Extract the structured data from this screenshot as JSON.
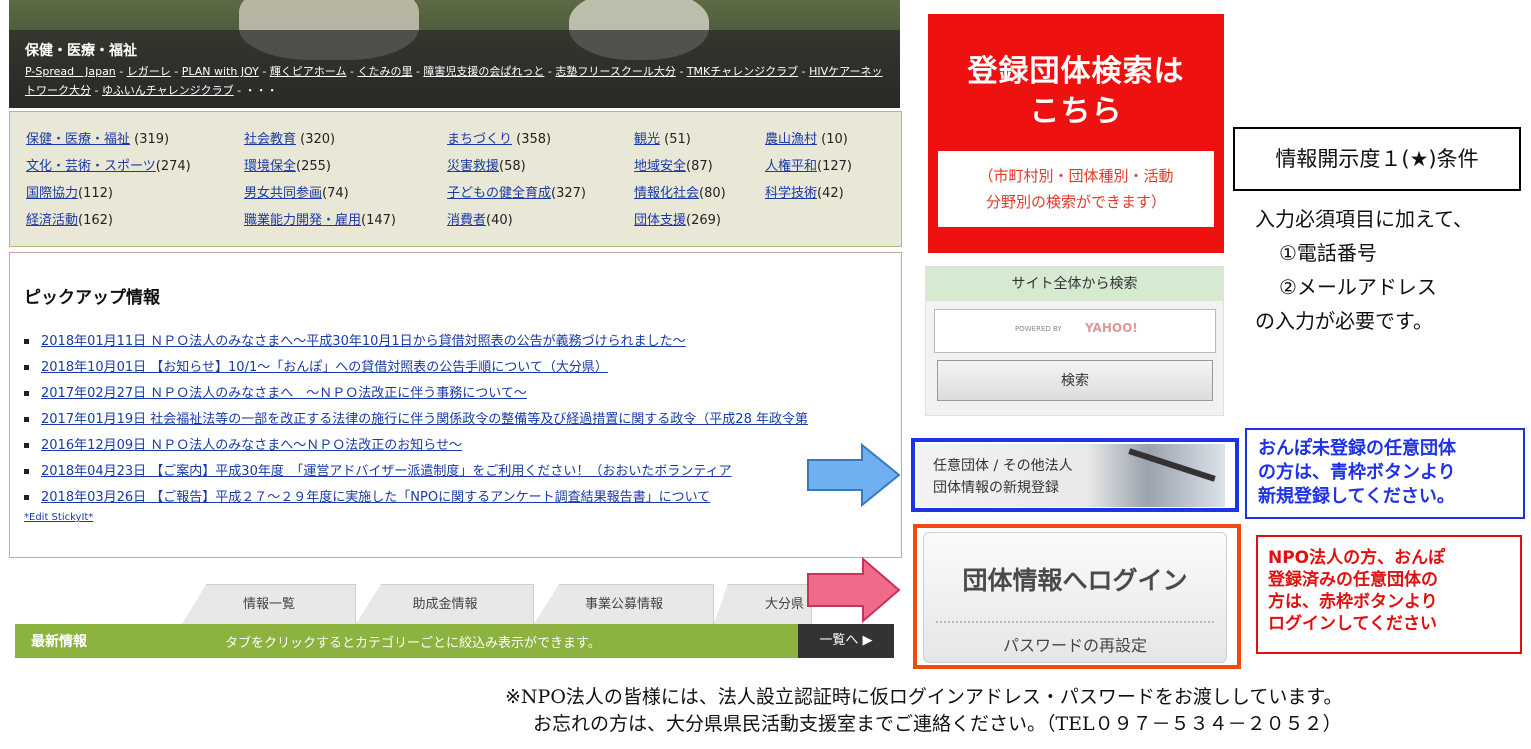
{
  "banner": {
    "category_title": "保健・医療・福祉",
    "links": [
      "P-Spread　Japan",
      "レガーレ",
      "PLAN with JOY",
      "輝くピアホーム",
      "くたみの里",
      "障害児支援の会ぱれっと",
      "志塾フリースクール大分",
      "TMKチャレンジクラブ",
      "HIVケアーネットワーク大分",
      "ゆふいんチャレンジクラブ"
    ],
    "separator": " - ",
    "trailing": " - ・・・"
  },
  "categories": [
    [
      {
        "name": "保健・医療・福祉",
        "count": " (319)"
      },
      {
        "name": "社会教育",
        "count": " (320)"
      },
      {
        "name": "まちづくり",
        "count": " (358)"
      },
      {
        "name": "観光",
        "count": " (51)"
      },
      {
        "name": "農山漁村",
        "count": " (10)"
      }
    ],
    [
      {
        "name": "文化・芸術・スポーツ",
        "count": "(274)"
      },
      {
        "name": "環境保全",
        "count": "(255)"
      },
      {
        "name": "災害救援",
        "count": "(58)"
      },
      {
        "name": "地域安全",
        "count": "(87)"
      },
      {
        "name": "人権平和",
        "count": "(127)"
      }
    ],
    [
      {
        "name": "国際協力",
        "count": "(112)"
      },
      {
        "name": "男女共同参画",
        "count": "(74)"
      },
      {
        "name": "子どもの健全育成",
        "count": "(327)"
      },
      {
        "name": "情報化社会",
        "count": "(80)"
      },
      {
        "name": "科学技術",
        "count": "(42)"
      }
    ],
    [
      {
        "name": "経済活動",
        "count": "(162)"
      },
      {
        "name": "職業能力開発・雇用",
        "count": "(147)"
      },
      {
        "name": "消費者",
        "count": "(40)"
      },
      {
        "name": "団体支援",
        "count": "(269)"
      }
    ]
  ],
  "pickup": {
    "title": "ピックアップ情報",
    "items": [
      "2018年01月11日 ＮＰＯ法人のみなさまへ～平成30年10月1日から貸借対照表の公告が義務づけられました～",
      "2018年10月01日 【お知らせ】10/1～「おんぽ」への貸借対照表の公告手順について（大分県）",
      "2017年02月27日 ＮＰＯ法人のみなさまへ　～ＮＰＯ法改正に伴う事務について～",
      "2017年01月19日 社会福祉法等の一部を改正する法律の施行に伴う関係政令の整備等及び経過措置に関する政令（平成28 年政令第",
      "2016年12月09日 ＮＰＯ法人のみなさまへ～ＮＰＯ法改正のお知らせ～",
      "2018年04月23日 【ご案内】平成30年度　「運営アドバイザー派遣制度」をご利用ください！（おおいたボランティア",
      "2018年03月26日 【ご報告】平成２７～２９年度に実施した「NPOに関するアンケート調査結果報告書」について"
    ],
    "edit_link": "*Edit StickyIt*"
  },
  "tabs": [
    "情報一覧",
    "助成金情報",
    "事業公募情報",
    "大分県"
  ],
  "latest": {
    "title": "最新情報",
    "hint": "タブをクリックするとカテゴリーごとに絞込み表示ができます。",
    "more": "一覧へ ▶"
  },
  "red_button": {
    "line1": "登録団体検索は",
    "line2": "こちら",
    "sub1": "（市町村別・団体種別・活動",
    "sub2": "分野別の検索ができます）"
  },
  "site_search": {
    "header": "サイト全体から検索",
    "powered_by": "POWERED BY",
    "yahoo": "YAHOO!",
    "button": "検索"
  },
  "blue_button": {
    "line1": "任意団体 / その他法人",
    "line2": "団体情報の新規登録"
  },
  "login_button": {
    "title": "団体情報へログイン",
    "reset": "パスワードの再設定"
  },
  "info_box": {
    "title": "情報開示度１(★)条件",
    "line1": "入力必須項目に加えて、",
    "line2": "①電話番号",
    "line3": "②メールアドレス",
    "line4": "の入力が必要です。"
  },
  "blue_note": {
    "line1": "おんぽ未登録の任意団体",
    "line2": "の方は、青枠ボタンより",
    "line3": "新規登録してください。"
  },
  "red_note": {
    "line1": "NPO法人の方、おんぽ",
    "line2": "登録済みの任意団体の",
    "line3": "方は、赤枠ボタンより",
    "line4": "ログインしてください"
  },
  "footer": {
    "line1": "※NPO法人の皆様には、法人設立認証時に仮ログインアドレス・パスワードをお渡ししています。",
    "line2": "お忘れの方は、大分県県民活動支援室までご連絡ください。（TEL０９７－５３４－２０５２）"
  },
  "colors": {
    "accent_red": "#ef1010",
    "accent_blue": "#1e32e8",
    "accent_orange": "#f04a10",
    "latest_green": "#8cb240",
    "category_bg": "#e9e7d6",
    "arrow_blue": "#6fb0f0",
    "arrow_pink": "#f06a8a"
  }
}
